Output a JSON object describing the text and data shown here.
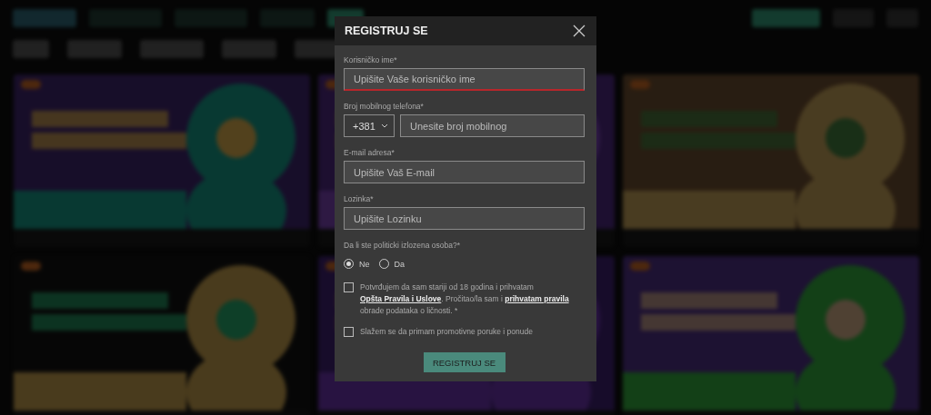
{
  "dialog": {
    "title": "REGISTRUJ SE",
    "username": {
      "label": "Korisničko ime*",
      "placeholder": "Upišite Vaše korisničko ime",
      "error": true
    },
    "phone": {
      "label": "Broj mobilnog telefona*",
      "prefix": "+381",
      "placeholder": "Unesite broj mobilnog",
      "error": false
    },
    "email": {
      "label": "E-mail adresa*",
      "placeholder": "Upišite Vaš E-mail",
      "error": false
    },
    "password": {
      "label": "Lozinka*",
      "placeholder": "Upišite Lozinku",
      "error": false
    },
    "pep": {
      "question": "Da li ste politicki izlozena osoba?*",
      "options": [
        {
          "label": "Ne",
          "selected": true
        },
        {
          "label": "Da",
          "selected": false
        }
      ]
    },
    "consents": [
      {
        "checked": false,
        "parts": [
          {
            "kind": "text",
            "text": "Potvrđujem da sam stariji od 18 godina i prihvatam "
          },
          {
            "kind": "link",
            "text": "Opšta Pravila i Uslove"
          },
          {
            "kind": "text",
            "text": ". Pročitao/la sam i "
          },
          {
            "kind": "link",
            "text": "prihvatam pravila"
          },
          {
            "kind": "text",
            "text": " obrade podataka o ličnosti. *"
          }
        ]
      },
      {
        "checked": false,
        "parts": [
          {
            "kind": "text",
            "text": "Slažem se da primam promotivne poruke i ponude"
          }
        ]
      }
    ],
    "submit": "REGISTRUJ SE"
  }
}
